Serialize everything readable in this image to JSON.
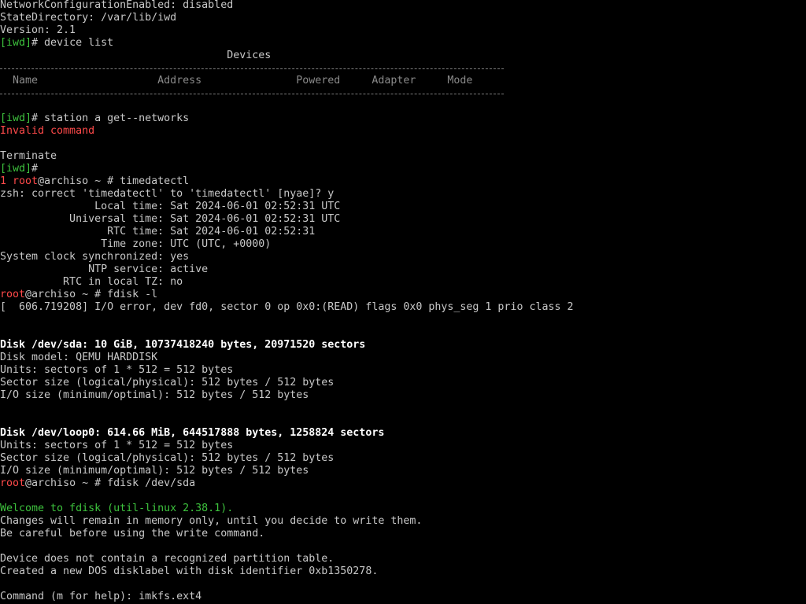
{
  "colors": {
    "background": "#000000",
    "text": "#c8c8c8",
    "bold_text": "#ffffff",
    "prompt_green": "#3dc23d",
    "error_red": "#ff4a4a",
    "table_header": "#8a8a8a"
  },
  "lines": {
    "l00": "NetworkConfigurationEnabled: disabled",
    "l01": "StateDirectory: /var/lib/iwd",
    "l02": "Version: 2.1",
    "l03_prompt": "[iwd]",
    "l03_cmd": "# device list",
    "l04_title": "                                    Devices",
    "l06_header": "  Name                   Address               Powered     Adapter     Mode",
    "l09_prompt": "[iwd]",
    "l09_cmd": "# station a get--networks",
    "l10_error": "Invalid command",
    "l12": "Terminate",
    "l13_prompt": "[iwd]",
    "l13_cmd": "#",
    "l14_num": "1 ",
    "l14_user": "root",
    "l14_rest": "@archiso ~ # timedatectl",
    "l15": "zsh: correct 'timedatectl' to 'timedatectl' [nyae]? y",
    "l16": "               Local time: Sat 2024-06-01 02:52:31 UTC",
    "l17": "           Universal time: Sat 2024-06-01 02:52:31 UTC",
    "l18": "                 RTC time: Sat 2024-06-01 02:52:31",
    "l19": "                Time zone: UTC (UTC, +0000)",
    "l20": "System clock synchronized: yes",
    "l21": "              NTP service: active",
    "l22": "          RTC in local TZ: no",
    "l23_user": "root",
    "l23_rest": "@archiso ~ # fdisk -l",
    "l24": "[  606.719208] I/O error, dev fd0, sector 0 op 0x0:(READ) flags 0x0 phys_seg 1 prio class 2",
    "l27": "Disk /dev/sda: 10 GiB, 10737418240 bytes, 20971520 sectors",
    "l28": "Disk model: QEMU HARDDISK",
    "l29": "Units: sectors of 1 * 512 = 512 bytes",
    "l30": "Sector size (logical/physical): 512 bytes / 512 bytes",
    "l31": "I/O size (minimum/optimal): 512 bytes / 512 bytes",
    "l34": "Disk /dev/loop0: 614.66 MiB, 644517888 bytes, 1258824 sectors",
    "l35": "Units: sectors of 1 * 512 = 512 bytes",
    "l36": "Sector size (logical/physical): 512 bytes / 512 bytes",
    "l37": "I/O size (minimum/optimal): 512 bytes / 512 bytes",
    "l38_user": "root",
    "l38_rest": "@archiso ~ # fdisk /dev/sda",
    "l40": "Welcome to fdisk (util-linux 2.38.1).",
    "l41": "Changes will remain in memory only, until you decide to write them.",
    "l42": "Be careful before using the write command.",
    "l44": "Device does not contain a recognized partition table.",
    "l45": "Created a new DOS disklabel with disk identifier 0xb1350278.",
    "l47": "Command (m for help): imkfs.ext4"
  }
}
